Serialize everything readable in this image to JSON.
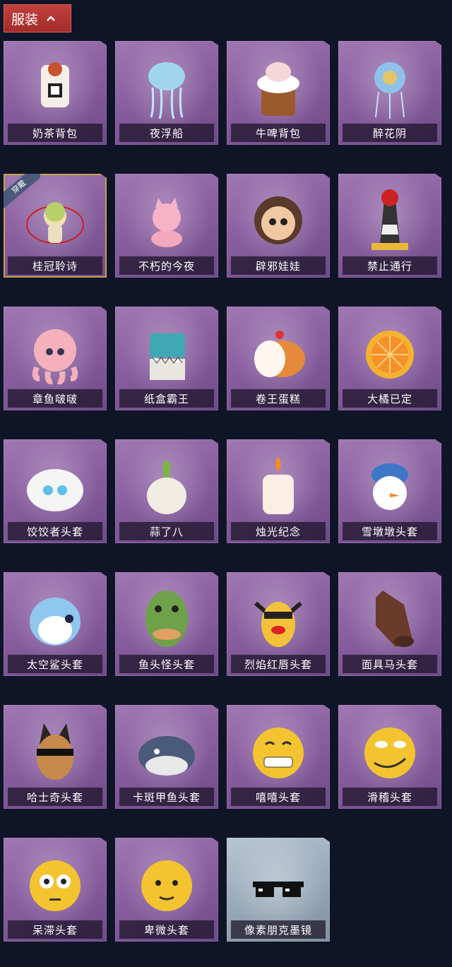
{
  "header": {
    "title": "服装",
    "toggle_icon": "chevron-up-icon"
  },
  "items": [
    {
      "label": "奶茶背包",
      "art": "milk-tea-icon"
    },
    {
      "label": "夜浮船",
      "art": "jellyfish-icon"
    },
    {
      "label": "牛啤背包",
      "art": "cow-beer-icon"
    },
    {
      "label": "醉花阴",
      "art": "flower-lantern-icon"
    },
    {
      "label": "桂冠聆诗",
      "art": "laurel-charm-icon",
      "badge": "穿戴"
    },
    {
      "label": "不朽的今夜",
      "art": "pink-fox-icon"
    },
    {
      "label": "辟邪娃娃",
      "art": "doll-icon"
    },
    {
      "label": "禁止通行",
      "art": "no-entry-cone-icon"
    },
    {
      "label": "章鱼啵啵",
      "art": "octopus-icon"
    },
    {
      "label": "纸盒霸王",
      "art": "box-dino-icon"
    },
    {
      "label": "卷王蛋糕",
      "art": "roll-cake-icon"
    },
    {
      "label": "大橘已定",
      "art": "orange-icon"
    },
    {
      "label": "饺饺者头套",
      "art": "dumpling-icon"
    },
    {
      "label": "蒜了八",
      "art": "garlic-icon"
    },
    {
      "label": "烛光纪念",
      "art": "candle-icon"
    },
    {
      "label": "雪墩墩头套",
      "art": "snowman-icon"
    },
    {
      "label": "太空鲨头套",
      "art": "shark-icon"
    },
    {
      "label": "鱼头怪头套",
      "art": "fish-head-icon"
    },
    {
      "label": "烈焰红唇头套",
      "art": "red-lips-icon"
    },
    {
      "label": "面具马头套",
      "art": "horse-mask-icon"
    },
    {
      "label": "哈士奇头套",
      "art": "husky-icon"
    },
    {
      "label": "卡斑甲鱼头套",
      "art": "fish-icon"
    },
    {
      "label": "嘻嘻头套",
      "art": "grin-emoji-icon"
    },
    {
      "label": "滑稽头套",
      "art": "funny-emoji-icon"
    },
    {
      "label": "呆滞头套",
      "art": "stare-emoji-icon"
    },
    {
      "label": "卑微头套",
      "art": "humble-emoji-icon"
    },
    {
      "label": "像素朋克墨镜",
      "art": "pixel-sunglasses-icon"
    }
  ]
}
